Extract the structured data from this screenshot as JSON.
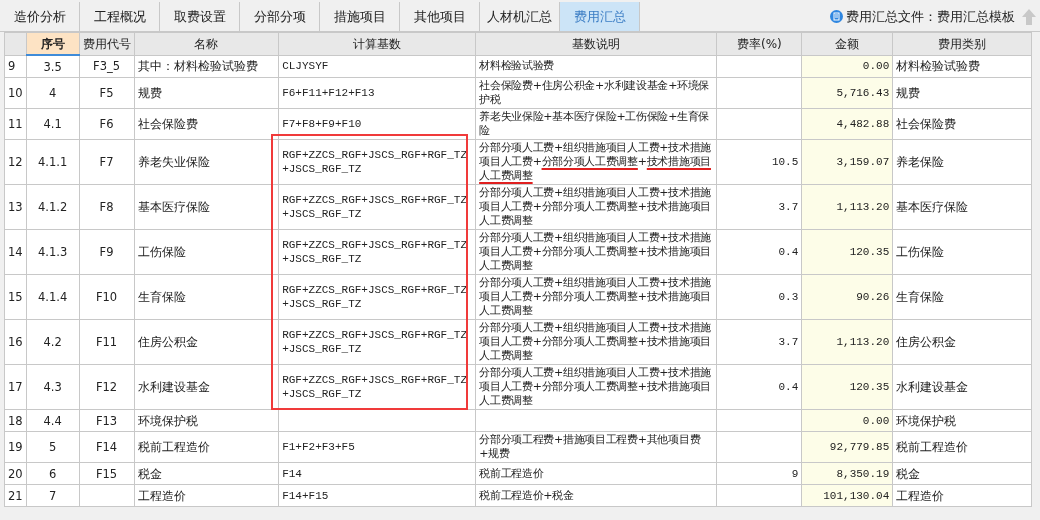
{
  "tabs": [
    {
      "label": "造价分析",
      "selected": false
    },
    {
      "label": "工程概况",
      "selected": false
    },
    {
      "label": "取费设置",
      "selected": false
    },
    {
      "label": "分部分项",
      "selected": false
    },
    {
      "label": "措施项目",
      "selected": false
    },
    {
      "label": "其他项目",
      "selected": false
    },
    {
      "label": "人材机汇总",
      "selected": false
    },
    {
      "label": "费用汇总",
      "selected": true
    }
  ],
  "file_label": "费用汇总文件：费用汇总模板",
  "table": {
    "columns": [
      {
        "label": "序号",
        "selected": true
      },
      {
        "label": "费用代号",
        "selected": false
      },
      {
        "label": "名称",
        "selected": false
      },
      {
        "label": "计算基数",
        "selected": false
      },
      {
        "label": "基数说明",
        "selected": false
      },
      {
        "label": "费率(%)",
        "selected": false
      },
      {
        "label": "金额",
        "selected": false
      },
      {
        "label": "费用类别",
        "selected": false
      }
    ],
    "rows": [
      {
        "row": "9",
        "no": "3.5",
        "code": "F3_5",
        "name": "其中：材料检验试验费",
        "basis": "CLJYSYF",
        "note": "材料检验试验费",
        "rate": "",
        "amount": "0.00",
        "category": "材料检验试验费",
        "basis_framed": false
      },
      {
        "row": "10",
        "no": "4",
        "code": "F5",
        "name": "规费",
        "basis": "F6+F11+F12+F13",
        "note": "社会保险费+住房公积金+水利建设基金+环境保护税",
        "rate": "",
        "amount": "5,716.43",
        "category": "规费",
        "basis_framed": false
      },
      {
        "row": "11",
        "no": "4.1",
        "code": "F6",
        "name": "社会保险费",
        "basis": "F7+F8+F9+F10",
        "note": "养老失业保险+基本医疗保险+工伤保险+生育保险",
        "rate": "",
        "amount": "4,482.88",
        "category": "社会保险费",
        "basis_framed": false
      },
      {
        "row": "12",
        "no": "4.1.1",
        "code": "F7",
        "name": "养老失业保险",
        "basis": "RGF+ZZCS_RGF+JSCS_RGF+RGF_TZ +JSCS_RGF_TZ",
        "note": [
          {
            "text": "分部分项人工费+组织措施项目人工费+技术措施项目人工费+",
            "underlined": false
          },
          {
            "text": "分部分项人工费调整",
            "underlined": true
          },
          {
            "text": "+",
            "underlined": false
          },
          {
            "text": "技术措施项目人工费调整",
            "underlined": true
          }
        ],
        "rate": "10.5",
        "amount": "3,159.07",
        "category": "养老保险",
        "basis_framed": true
      },
      {
        "row": "13",
        "no": "4.1.2",
        "code": "F8",
        "name": "基本医疗保险",
        "basis": "RGF+ZZCS_RGF+JSCS_RGF+RGF_TZ +JSCS_RGF_TZ",
        "note": "分部分项人工费+组织措施项目人工费+技术措施项目人工费+分部分项人工费调整+技术措施项目人工费调整",
        "rate": "3.7",
        "amount": "1,113.20",
        "category": "基本医疗保险",
        "basis_framed": true
      },
      {
        "row": "14",
        "no": "4.1.3",
        "code": "F9",
        "name": "工伤保险",
        "basis": "RGF+ZZCS_RGF+JSCS_RGF+RGF_TZ +JSCS_RGF_TZ",
        "note": "分部分项人工费+组织措施项目人工费+技术措施项目人工费+分部分项人工费调整+技术措施项目人工费调整",
        "rate": "0.4",
        "amount": "120.35",
        "category": "工伤保险",
        "basis_framed": true
      },
      {
        "row": "15",
        "no": "4.1.4",
        "code": "F10",
        "name": "生育保险",
        "basis": "RGF+ZZCS_RGF+JSCS_RGF+RGF_TZ +JSCS_RGF_TZ",
        "note": "分部分项人工费+组织措施项目人工费+技术措施项目人工费+分部分项人工费调整+技术措施项目人工费调整",
        "rate": "0.3",
        "amount": "90.26",
        "category": "生育保险",
        "basis_framed": true
      },
      {
        "row": "16",
        "no": "4.2",
        "code": "F11",
        "name": "住房公积金",
        "basis": "RGF+ZZCS_RGF+JSCS_RGF+RGF_TZ +JSCS_RGF_TZ",
        "note": "分部分项人工费+组织措施项目人工费+技术措施项目人工费+分部分项人工费调整+技术措施项目人工费调整",
        "rate": "3.7",
        "amount": "1,113.20",
        "category": "住房公积金",
        "basis_framed": true
      },
      {
        "row": "17",
        "no": "4.3",
        "code": "F12",
        "name": "水利建设基金",
        "basis": "RGF+ZZCS_RGF+JSCS_RGF+RGF_TZ +JSCS_RGF_TZ",
        "note": "分部分项人工费+组织措施项目人工费+技术措施项目人工费+分部分项人工费调整+技术措施项目人工费调整",
        "rate": "0.4",
        "amount": "120.35",
        "category": "水利建设基金",
        "basis_framed": true
      },
      {
        "row": "18",
        "no": "4.4",
        "code": "F13",
        "name": "环境保护税",
        "basis": "",
        "note": "",
        "rate": "",
        "amount": "0.00",
        "category": "环境保护税",
        "basis_framed": false
      },
      {
        "row": "19",
        "no": "5",
        "code": "F14",
        "name": "税前工程造价",
        "basis": "F1+F2+F3+F5",
        "note": "分部分项工程费+措施项目工程费+其他项目费+规费",
        "rate": "",
        "amount": "92,779.85",
        "category": "税前工程造价",
        "basis_framed": false
      },
      {
        "row": "20",
        "no": "6",
        "code": "F15",
        "name": "税金",
        "basis": "F14",
        "note": "税前工程造价",
        "rate": "9",
        "amount": "8,350.19",
        "category": "税金",
        "basis_framed": false
      },
      {
        "row": "21",
        "no": "7",
        "code": "",
        "name": "工程造价",
        "basis": "F14+F15",
        "note": "税前工程造价+税金",
        "rate": "",
        "amount": "101,130.04",
        "category": "工程造价",
        "basis_framed": false
      }
    ]
  }
}
